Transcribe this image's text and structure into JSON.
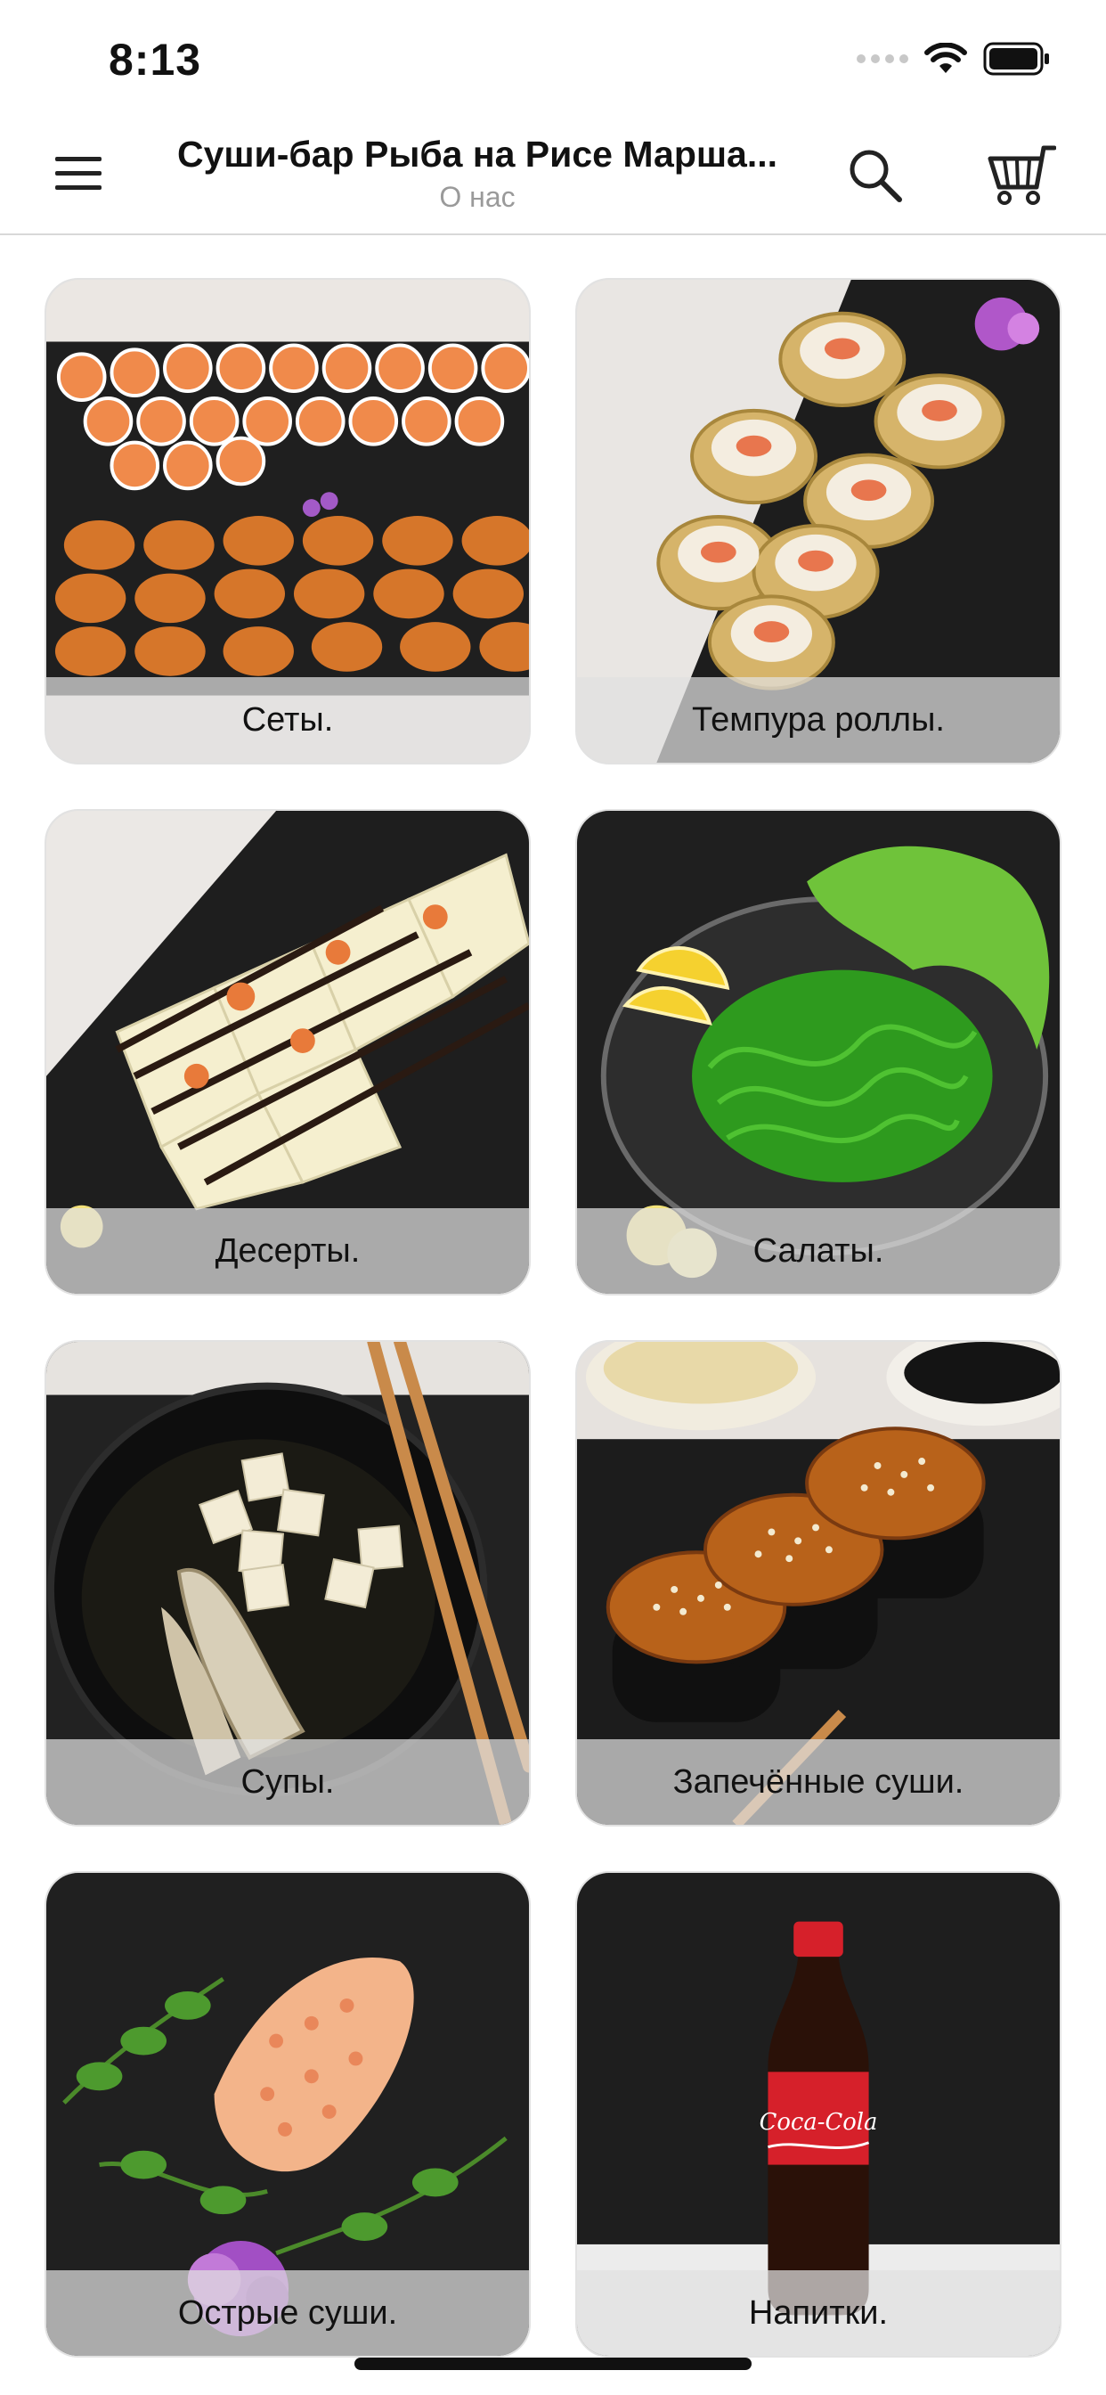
{
  "status": {
    "time": "8:13"
  },
  "header": {
    "title": "Суши-бар Рыба на Рисе Марша...",
    "subtitle": "О нас"
  },
  "icons": {
    "menu": "hamburger-icon",
    "search": "search-icon",
    "cart": "cart-icon"
  },
  "categories": [
    {
      "label": "Сеты."
    },
    {
      "label": "Темпура роллы."
    },
    {
      "label": "Десерты."
    },
    {
      "label": "Салаты."
    },
    {
      "label": "Супы."
    },
    {
      "label": "Запечённые суши."
    },
    {
      "label": "Острые суши."
    },
    {
      "label": "Напитки."
    }
  ]
}
